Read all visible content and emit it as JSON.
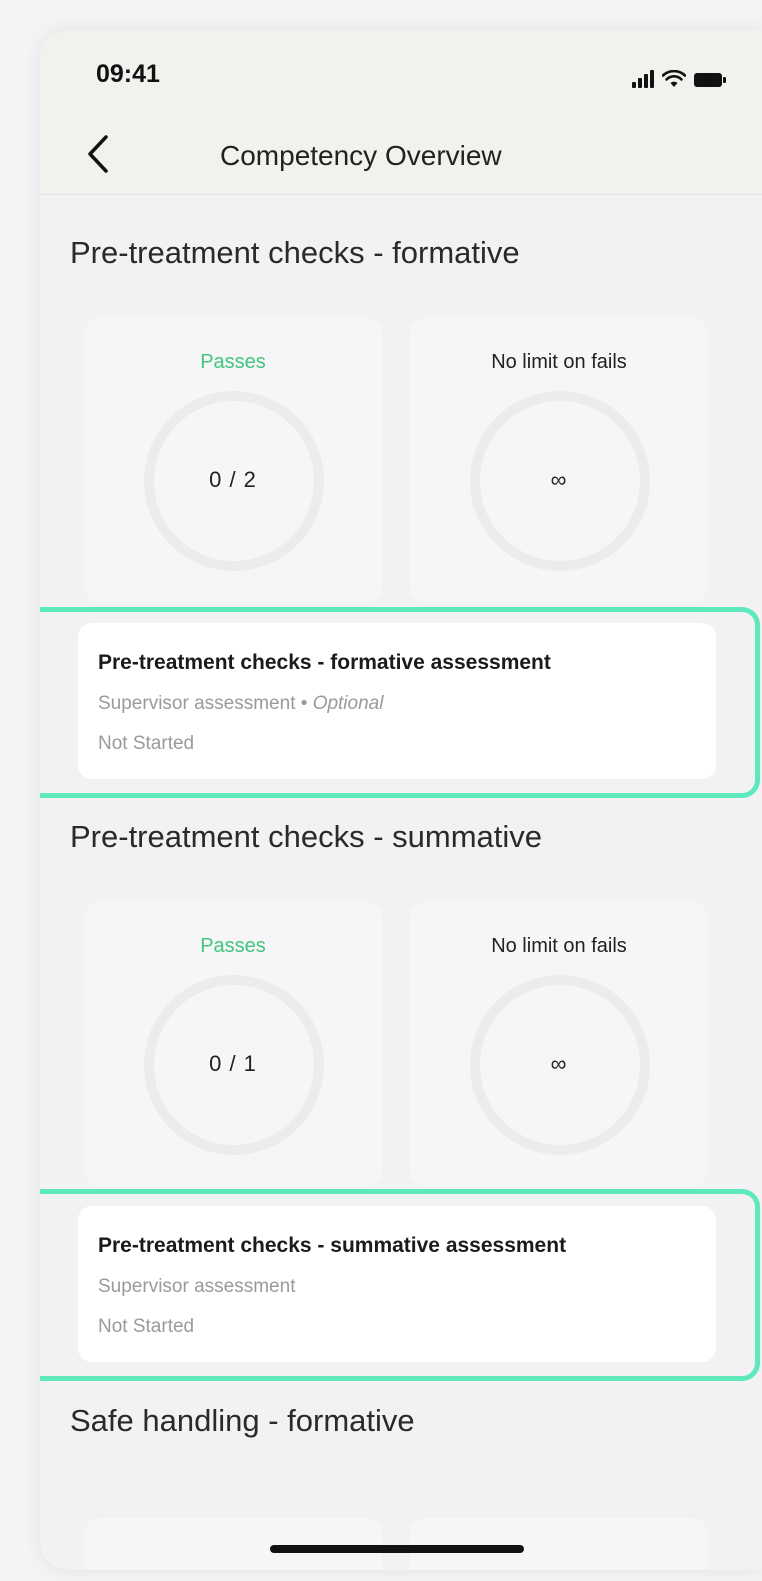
{
  "status_bar": {
    "time": "09:41",
    "icons": [
      "signal-icon",
      "wifi-icon",
      "battery-icon"
    ]
  },
  "nav": {
    "back_icon": "chevron-left-icon",
    "title": "Competency Overview"
  },
  "colors": {
    "accent_green": "#41c47b",
    "highlight_border": "#5ee9bd"
  },
  "sections": [
    {
      "title": "Pre-treatment checks - formative",
      "passes_label": "Passes",
      "passes_value": "0 / 2",
      "passes_progress": 0,
      "fails_label": "No limit on fails",
      "fails_value": "∞",
      "assessment": {
        "title": "Pre-treatment checks - formative assessment",
        "type": "Supervisor assessment",
        "separator": " • ",
        "optional": "Optional",
        "status": "Not Started"
      }
    },
    {
      "title": "Pre-treatment checks - summative",
      "passes_label": "Passes",
      "passes_value": "0 / 1",
      "passes_progress": 0,
      "fails_label": "No limit on fails",
      "fails_value": "∞",
      "assessment": {
        "title": "Pre-treatment checks - summative assessment",
        "type": "Supervisor assessment",
        "status": "Not Started"
      }
    },
    {
      "title": "Safe handling - formative"
    }
  ]
}
